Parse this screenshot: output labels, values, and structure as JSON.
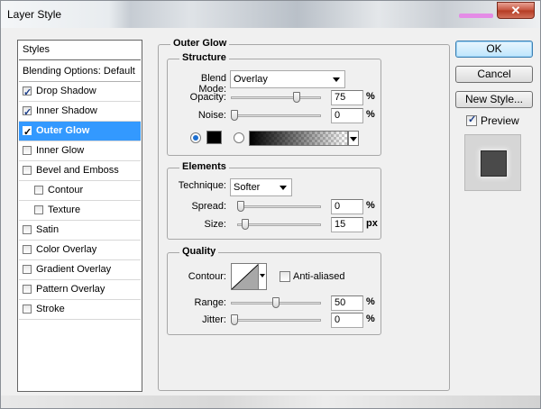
{
  "window": {
    "title": "Layer Style",
    "close_glyph": "✕"
  },
  "styles_list": [
    {
      "label": "Styles",
      "checkbox": false,
      "checked": false,
      "indent": false,
      "selected": false,
      "bold": false
    },
    {
      "label": "Blending Options: Default",
      "checkbox": false,
      "checked": false,
      "indent": false,
      "selected": false,
      "bold": false
    },
    {
      "label": "Drop Shadow",
      "checkbox": true,
      "checked": true,
      "indent": false,
      "selected": false,
      "bold": false
    },
    {
      "label": "Inner Shadow",
      "checkbox": true,
      "checked": true,
      "indent": false,
      "selected": false,
      "bold": false
    },
    {
      "label": "Outer Glow",
      "checkbox": true,
      "checked": true,
      "indent": false,
      "selected": true,
      "bold": true
    },
    {
      "label": "Inner Glow",
      "checkbox": true,
      "checked": false,
      "indent": false,
      "selected": false,
      "bold": false
    },
    {
      "label": "Bevel and Emboss",
      "checkbox": true,
      "checked": false,
      "indent": false,
      "selected": false,
      "bold": false
    },
    {
      "label": "Contour",
      "checkbox": true,
      "checked": false,
      "indent": true,
      "selected": false,
      "bold": false
    },
    {
      "label": "Texture",
      "checkbox": true,
      "checked": false,
      "indent": true,
      "selected": false,
      "bold": false
    },
    {
      "label": "Satin",
      "checkbox": true,
      "checked": false,
      "indent": false,
      "selected": false,
      "bold": false
    },
    {
      "label": "Color Overlay",
      "checkbox": true,
      "checked": false,
      "indent": false,
      "selected": false,
      "bold": false
    },
    {
      "label": "Gradient Overlay",
      "checkbox": true,
      "checked": false,
      "indent": false,
      "selected": false,
      "bold": false
    },
    {
      "label": "Pattern Overlay",
      "checkbox": true,
      "checked": false,
      "indent": false,
      "selected": false,
      "bold": false
    },
    {
      "label": "Stroke",
      "checkbox": true,
      "checked": false,
      "indent": false,
      "selected": false,
      "bold": false
    }
  ],
  "outer_glow": {
    "title": "Outer Glow",
    "structure": {
      "title": "Structure",
      "blend_mode_label": "Blend Mode:",
      "blend_mode_value": "Overlay",
      "opacity_label": "Opacity:",
      "opacity_value": "75",
      "opacity_pct": 75,
      "noise_label": "Noise:",
      "noise_value": "0",
      "noise_pct": 0,
      "color_hex": "#000000"
    },
    "elements": {
      "title": "Elements",
      "technique_label": "Technique:",
      "technique_value": "Softer",
      "spread_label": "Spread:",
      "spread_value": "0",
      "spread_pct": 0,
      "size_label": "Size:",
      "size_value": "15",
      "size_fraction": 0.06
    },
    "quality": {
      "title": "Quality",
      "contour_label": "Contour:",
      "antialiased_label": "Anti-aliased",
      "antialiased_checked": false,
      "range_label": "Range:",
      "range_value": "50",
      "range_pct": 50,
      "jitter_label": "Jitter:",
      "jitter_value": "0",
      "jitter_pct": 0
    }
  },
  "units": {
    "percent": "%",
    "px": "px"
  },
  "buttons": {
    "ok": "OK",
    "cancel": "Cancel",
    "new_style": "New Style..."
  },
  "preview": {
    "label": "Preview",
    "checked": true
  }
}
